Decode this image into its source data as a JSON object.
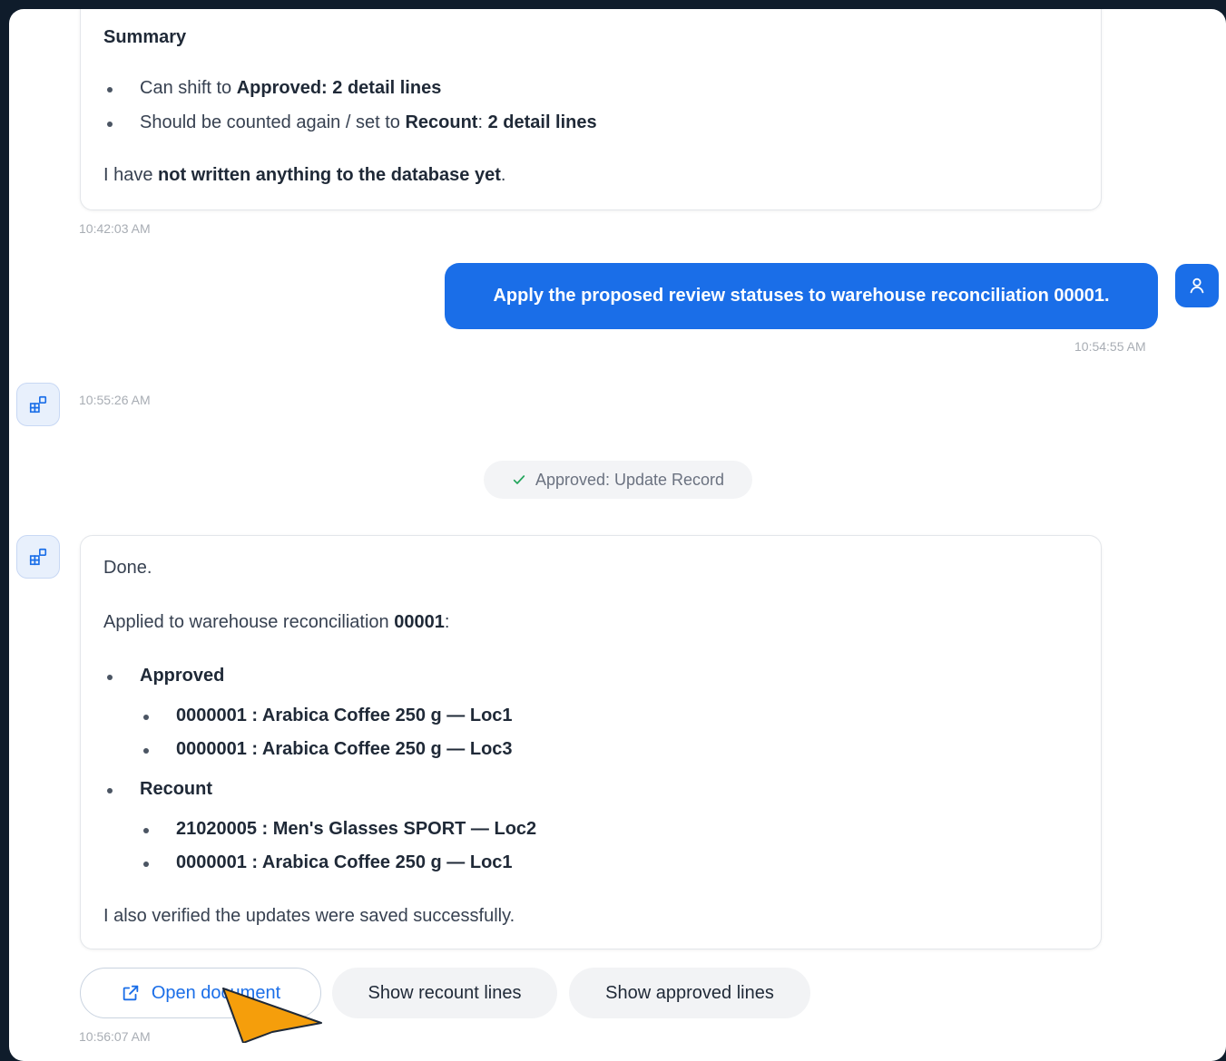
{
  "messages": {
    "summary": {
      "heading": "Summary",
      "item1_prefix": "Can shift to ",
      "item1_bold": "Approved: 2 detail lines",
      "item2_prefix": "Should be counted again / set to ",
      "item2_bold1": "Recount",
      "item2_colon": ": ",
      "item2_bold2": "2 detail lines",
      "note_prefix": "I have ",
      "note_bold": "not written anything to the database yet",
      "note_suffix": ".",
      "time": "10:42:03 AM"
    },
    "user": {
      "text": "Apply the proposed review statuses to warehouse reconciliation 00001.",
      "time": "10:54:55 AM"
    },
    "ai_empty": {
      "time": "10:55:26 AM"
    },
    "status": {
      "label": "Approved: Update Record",
      "icon": "check-icon"
    },
    "done": {
      "line1": "Done.",
      "applied_prefix": "Applied to warehouse reconciliation ",
      "applied_bold": "00001",
      "applied_suffix": ":",
      "approved_heading": "Approved",
      "approved_items": [
        "0000001 : Arabica Coffee 250 g — Loc1",
        "0000001 : Arabica Coffee 250 g — Loc3"
      ],
      "recount_heading": "Recount",
      "recount_items": [
        "21020005 : Men's Glasses SPORT — Loc2",
        "0000001 : Arabica Coffee 250 g — Loc1"
      ],
      "verified": "I also verified the updates were saved successfully.",
      "time": "10:56:07 AM"
    }
  },
  "actions": {
    "open_document": "Open document",
    "show_recount": "Show recount lines",
    "show_approved": "Show approved lines"
  },
  "colors": {
    "accent": "#1a6ee8",
    "background": "#0f1c2b",
    "cursor": "#f59e0b"
  }
}
